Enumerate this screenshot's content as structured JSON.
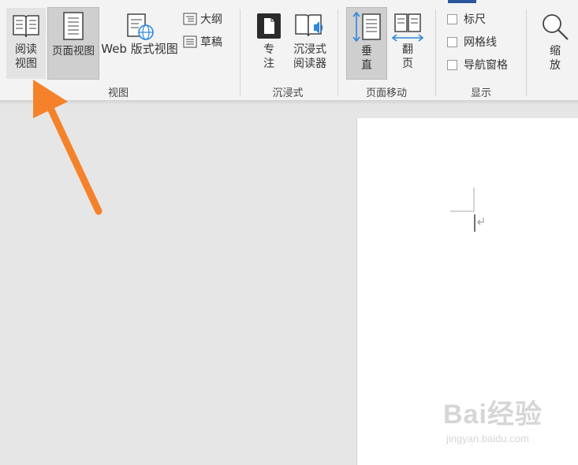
{
  "ribbon": {
    "view_group": {
      "label": "视图",
      "read_mode": "阅读\n视图",
      "print_layout": "页面视图",
      "web_layout": "Web 版式视图",
      "outline": "大纲",
      "draft": "草稿"
    },
    "immersive_group": {
      "label": "沉浸式",
      "focus": "专\n注",
      "immersive_reader": "沉浸式\n阅读器"
    },
    "page_movement_group": {
      "label": "页面移动",
      "vertical": "垂\n直",
      "side_to_side": "翻\n页"
    },
    "show_group": {
      "label": "显示",
      "ruler": "标尺",
      "gridlines": "网格线",
      "navigation_pane": "导航窗格"
    },
    "zoom": {
      "label": "缩\n放"
    }
  },
  "watermark": {
    "brand": "Bai经验",
    "url": "jingyan.baidu.com"
  },
  "colors": {
    "accent_tab": "#2b579a",
    "arrow": "#f5822a",
    "icon_blue": "#2e86de"
  }
}
